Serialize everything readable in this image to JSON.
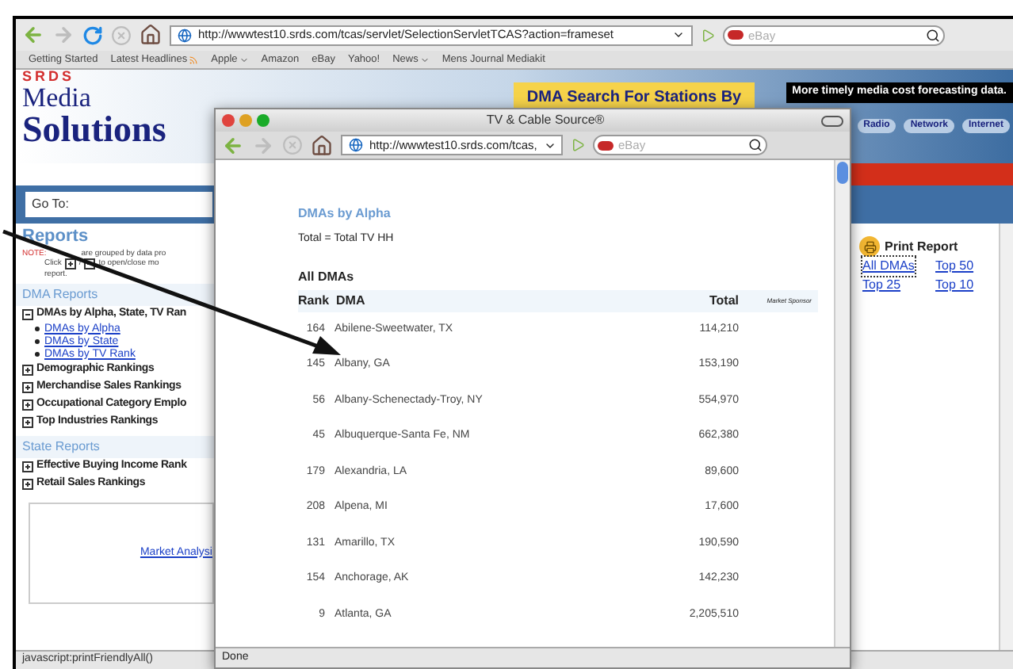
{
  "browser": {
    "url": "http://wwwtest10.srds.com/tcas/servlet/SelectionServletTCAS?action=frameset",
    "search_placeholder": "eBay",
    "bookmarks": [
      {
        "label": "Getting Started",
        "kind": "link"
      },
      {
        "label": "Latest Headlines",
        "kind": "feed"
      },
      {
        "label": "Apple",
        "kind": "menu"
      },
      {
        "label": "Amazon",
        "kind": "link"
      },
      {
        "label": "eBay",
        "kind": "link"
      },
      {
        "label": "Yahoo!",
        "kind": "link"
      },
      {
        "label": "News",
        "kind": "menu"
      },
      {
        "label": "Mens Journal Mediakit",
        "kind": "link"
      }
    ]
  },
  "header": {
    "logo_brand": "SRDS",
    "logo_line1": "Media",
    "logo_line2": "Solutions",
    "promo": "DMA Search For Stations By",
    "tagline": "More timely media cost forecasting data.",
    "nav": [
      "Radio",
      "Network",
      "Internet"
    ]
  },
  "goto": {
    "label": "Go To:"
  },
  "sidebar": {
    "title": "Reports",
    "note_prefix": "NOTE:",
    "note": "are grouped by data pro",
    "click_before": "Click",
    "click_sep": "/",
    "click_after": "to open/close mo",
    "note_end": "report.",
    "sections": [
      {
        "title": "DMA Reports",
        "items": [
          {
            "label": "DMAs by Alpha, State, TV Ran",
            "expanded": true,
            "children": [
              {
                "label": "DMAs by Alpha"
              },
              {
                "label": "DMAs by State"
              },
              {
                "label": "DMAs by TV Rank"
              }
            ]
          },
          {
            "label": "Demographic Rankings",
            "expanded": false
          },
          {
            "label": "Merchandise Sales Rankings",
            "expanded": false
          },
          {
            "label": "Occupational Category Emplo",
            "expanded": false
          },
          {
            "label": "Top Industries Rankings",
            "expanded": false
          }
        ]
      },
      {
        "title": "State Reports",
        "items": [
          {
            "label": "Effective Buying Income Rank",
            "expanded": false
          },
          {
            "label": "Retail Sales Rankings",
            "expanded": false
          }
        ]
      }
    ],
    "market_link": "Market Analysi"
  },
  "print_panel": {
    "title": "Print Report",
    "links": [
      {
        "label": "All DMAs",
        "selected": true
      },
      {
        "label": "Top 50",
        "selected": false
      },
      {
        "label": "Top 25",
        "selected": false
      },
      {
        "label": "Top 10",
        "selected": false
      }
    ]
  },
  "status_bar": "javascript:printFriendlyAll()",
  "popup": {
    "title": "TV & Cable Source®",
    "url": "http://wwwtest10.srds.com/tcas,",
    "search_placeholder": "eBay",
    "heading": "DMAs by Alpha",
    "subtitle": "Total = Total TV HH",
    "section": "All DMAs",
    "columns": [
      "Rank",
      "DMA",
      "Total",
      "Market Sponsor"
    ],
    "rows": [
      [
        "164",
        "Abilene-Sweetwater, TX",
        "114,210"
      ],
      [
        "145",
        "Albany, GA",
        "153,190"
      ],
      [
        "56",
        "Albany-Schenectady-Troy, NY",
        "554,970"
      ],
      [
        "45",
        "Albuquerque-Santa Fe, NM",
        "662,380"
      ],
      [
        "179",
        "Alexandria, LA",
        "89,600"
      ],
      [
        "208",
        "Alpena, MI",
        "17,600"
      ],
      [
        "131",
        "Amarillo, TX",
        "190,590"
      ],
      [
        "154",
        "Anchorage, AK",
        "142,230"
      ],
      [
        "9",
        "Atlanta, GA",
        "2,205,510"
      ]
    ],
    "status": "Done"
  }
}
